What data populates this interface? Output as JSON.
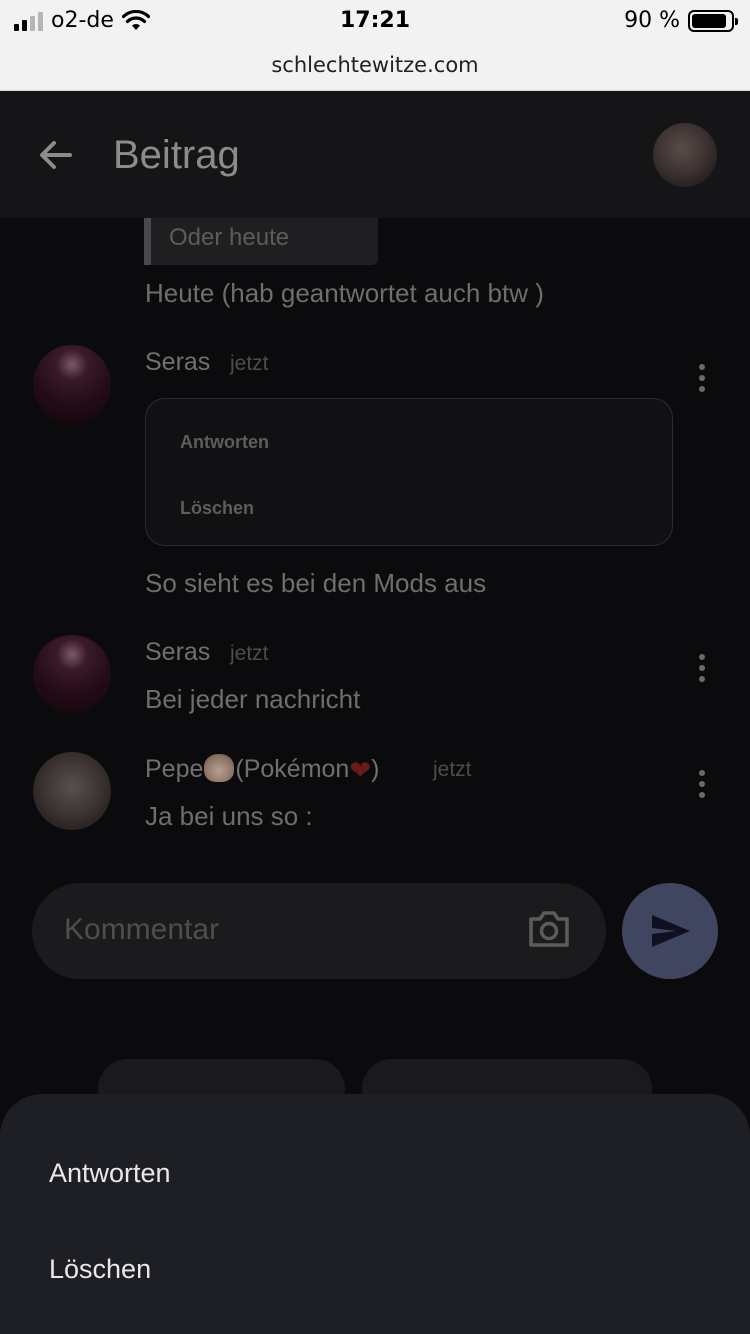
{
  "status_bar": {
    "carrier": "o2-de",
    "time": "17:21",
    "battery": "90 %"
  },
  "browser": {
    "url": "schlechtewitze.com"
  },
  "header": {
    "title": "Beitrag"
  },
  "feed": {
    "quote": "Oder heute",
    "reply_text": "Heute (hab geantwortet auch btw )",
    "comments": [
      {
        "author": "Seras",
        "time": "jetzt",
        "menu_items": [
          "Antworten",
          "Löschen"
        ],
        "text": "So sieht es bei den Mods aus"
      },
      {
        "author": "Seras",
        "time": "jetzt",
        "text": "Bei jeder nachricht"
      },
      {
        "author_prefix": "Pepe",
        "author_suffix": "(Pokémon",
        "author_close": ")",
        "time": "jetzt",
        "text": "Ja bei uns so :"
      }
    ]
  },
  "composer": {
    "placeholder": "Kommentar"
  },
  "bottom_sheet": {
    "items": [
      "Antworten",
      "Löschen"
    ]
  }
}
